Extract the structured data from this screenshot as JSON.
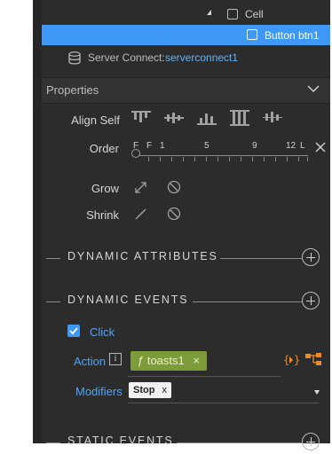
{
  "tree": {
    "cell_label": "Cell",
    "button_label": "Button btn1",
    "server_connect_prefix": "Server Connect:",
    "server_connect_name": "serverconnect1"
  },
  "properties": {
    "title": "Properties",
    "align_self_label": "Align Self",
    "order_label": "Order",
    "order_scale": [
      "F",
      "F",
      "1",
      "5",
      "9",
      "12",
      "L"
    ],
    "grow_label": "Grow",
    "shrink_label": "Shrink"
  },
  "sections": {
    "dynamic_attributes": "DYNAMIC ATTRIBUTES",
    "dynamic_events": "DYNAMIC EVENTS",
    "static_events": "STATIC EVENTS"
  },
  "event": {
    "click_label": "Click",
    "action_label": "Action",
    "action_value": "ƒ toasts1",
    "action_remove": "×",
    "modifiers_label": "Modifiers",
    "modifier_value": "Stop",
    "modifier_remove": "x"
  },
  "colors": {
    "accent": "#3e98f5",
    "panel_bg": "#2c2c2c",
    "chip_green": "#7e9b3a",
    "link_blue": "#4da3ff",
    "orange": "#f08a24"
  }
}
